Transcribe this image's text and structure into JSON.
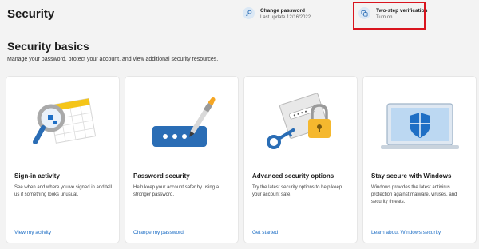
{
  "header": {
    "title": "Security",
    "actions": [
      {
        "title": "Change password",
        "subtitle": "Last update 12/16/2022",
        "icon": "key-icon"
      },
      {
        "title": "Two-step verification",
        "subtitle": "Turn on",
        "icon": "two-step-verification-icon"
      }
    ]
  },
  "section": {
    "title": "Security basics",
    "description": "Manage your password, protect your account, and view additional security resources."
  },
  "cards": [
    {
      "title": "Sign-in activity",
      "description": "See when and where you've signed in and tell us if something looks unusual.",
      "link": "View my activity",
      "icon": "magnifier-calendar-icon"
    },
    {
      "title": "Password security",
      "description": "Help keep your account safer by using a stronger password.",
      "link": "Change my password",
      "icon": "password-pen-icon"
    },
    {
      "title": "Advanced security options",
      "description": "Try the latest security options to help keep your account safe.",
      "link": "Get started",
      "icon": "lock-key-icon"
    },
    {
      "title": "Stay secure with Windows",
      "description": "Windows provides the latest antivirus protection against malware, viruses, and security threats.",
      "link": "Learn about Windows security",
      "icon": "laptop-shield-icon"
    }
  ],
  "colors": {
    "accent": "#1f6fc5",
    "highlight": "#d9141e",
    "background": "#f3f3f3"
  }
}
